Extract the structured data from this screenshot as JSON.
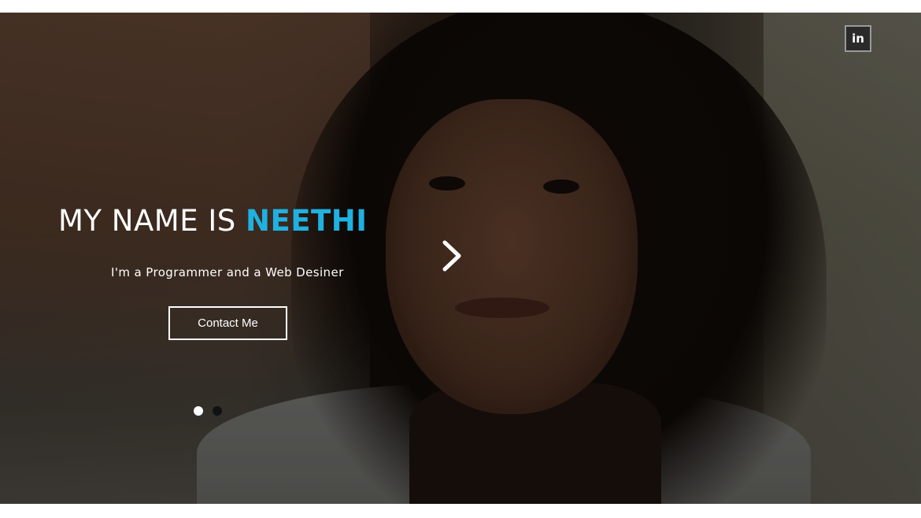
{
  "hero": {
    "headline_prefix": "MY NAME IS ",
    "headline_name": "NEETHI",
    "tagline": "I'm a Programmer and a Web Desiner",
    "contact_label": "Contact Me",
    "social": {
      "linkedin_label": "in",
      "icon": "linkedin-icon"
    },
    "carousel": {
      "next_icon": "chevron-right-icon",
      "slide_count": 2,
      "active_index": 0
    }
  },
  "colors": {
    "accent": "#1fb1e0",
    "text": "#ffffff",
    "dot_inactive": "#111111"
  }
}
